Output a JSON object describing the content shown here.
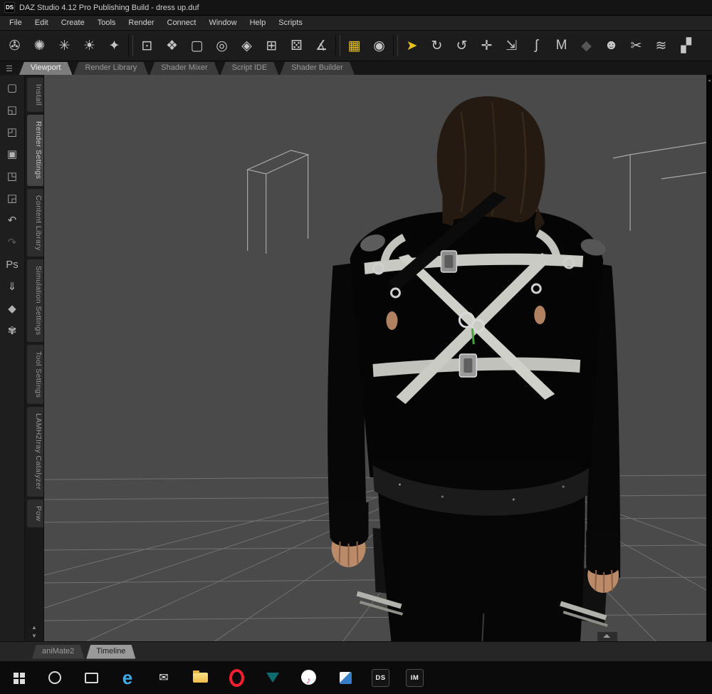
{
  "window": {
    "title": "DAZ Studio 4.12 Pro Publishing Build - dress up.duf",
    "app_initials": "DS"
  },
  "glyphs": {
    "pane_menu": "☰",
    "scroll_up": "▲",
    "scroll_down": "▼",
    "dock_handle": "◂"
  },
  "accent_colors": {
    "tool_highlight": "#e7c31d",
    "viewport_bg": "#4a4a4a"
  },
  "menu": {
    "items": [
      {
        "label": "File",
        "name": "menu-file"
      },
      {
        "label": "Edit",
        "name": "menu-edit"
      },
      {
        "label": "Create",
        "name": "menu-create"
      },
      {
        "label": "Tools",
        "name": "menu-tools"
      },
      {
        "label": "Render",
        "name": "menu-render"
      },
      {
        "label": "Connect",
        "name": "menu-connect"
      },
      {
        "label": "Window",
        "name": "menu-window"
      },
      {
        "label": "Help",
        "name": "menu-help"
      },
      {
        "label": "Scripts",
        "name": "menu-scripts"
      }
    ]
  },
  "toolbar": {
    "icons": [
      {
        "name": "new-camera-icon",
        "glyph": "✇"
      },
      {
        "name": "new-spotlight-icon",
        "glyph": "✺"
      },
      {
        "name": "new-point-light-icon",
        "glyph": "✳"
      },
      {
        "name": "new-distant-light-icon",
        "glyph": "☀"
      },
      {
        "name": "new-linear-light-icon",
        "glyph": "✦"
      },
      {
        "sep": true,
        "glyph": ""
      },
      {
        "name": "frame-camera-icon",
        "glyph": "⊡"
      },
      {
        "name": "new-primitive-icon",
        "glyph": "❖"
      },
      {
        "name": "bounding-box-icon",
        "glyph": "▢"
      },
      {
        "name": "aim-at-icon",
        "glyph": "◎"
      },
      {
        "name": "group-node-icon",
        "glyph": "◈"
      },
      {
        "name": "create-node-icon",
        "glyph": "⊞"
      },
      {
        "name": "instance-node-icon",
        "glyph": "⚄"
      },
      {
        "name": "measure-metrics-icon",
        "glyph": "∡"
      },
      {
        "sep": true,
        "glyph": ""
      },
      {
        "name": "render-icon",
        "glyph": "▦",
        "color": "#e7c31d"
      },
      {
        "name": "aux-viewport-icon",
        "glyph": "◉"
      },
      {
        "sep": true,
        "glyph": ""
      },
      {
        "name": "node-selection-tool-icon",
        "glyph": "➤",
        "color": "#e7c31d"
      },
      {
        "name": "rotate-tool-icon",
        "glyph": "↻"
      },
      {
        "name": "twist-tool-icon",
        "glyph": "↺"
      },
      {
        "name": "translate-tool-icon",
        "glyph": "✛"
      },
      {
        "name": "scale-tool-icon",
        "glyph": "⇲"
      },
      {
        "name": "active-pose-tool-icon",
        "glyph": "ʃ"
      },
      {
        "name": "surface-selection-tool-icon",
        "glyph": "M"
      },
      {
        "name": "node-weight-brush-icon",
        "glyph": "◆",
        "color": "#555555"
      },
      {
        "name": "joint-editor-tool-icon",
        "glyph": "☻"
      },
      {
        "name": "geometry-editor-tool-icon",
        "glyph": "✂"
      },
      {
        "name": "hair-tool-icon",
        "glyph": "≋"
      },
      {
        "name": "transfer-utility-icon",
        "glyph": "▞"
      }
    ]
  },
  "doc_tabs": {
    "items": [
      {
        "label": "Viewport",
        "name": "tab-viewport",
        "active": true
      },
      {
        "label": "Render Library",
        "name": "tab-render-library"
      },
      {
        "label": "Shader Mixer",
        "name": "tab-shader-mixer"
      },
      {
        "label": "Script IDE",
        "name": "tab-script-ide"
      },
      {
        "label": "Shader Builder",
        "name": "tab-shader-builder"
      }
    ]
  },
  "left_toolbar": {
    "icons": [
      {
        "name": "new-file-icon",
        "glyph": "▢"
      },
      {
        "name": "open-file-icon",
        "glyph": "◱"
      },
      {
        "name": "merge-file-icon",
        "glyph": "◰"
      },
      {
        "name": "save-icon",
        "glyph": "▣"
      },
      {
        "name": "save-last-icon",
        "glyph": "◳"
      },
      {
        "name": "export-icon",
        "glyph": "◲"
      },
      {
        "name": "undo-icon",
        "glyph": "↶"
      },
      {
        "name": "redo-icon",
        "glyph": "↷",
        "color": "#5a5a5a"
      },
      {
        "name": "photoshop-bridge-icon",
        "glyph": "Ps"
      },
      {
        "name": "render-queue-icon",
        "glyph": "⇓"
      },
      {
        "name": "smart-content-icon",
        "glyph": "◆"
      },
      {
        "name": "figure-setup-icon",
        "glyph": "✾"
      }
    ]
  },
  "side_tabs": {
    "items": [
      {
        "label": "Install",
        "name": "side-tab-install"
      },
      {
        "label": "Render Settings",
        "name": "side-tab-render-settings",
        "active": true
      },
      {
        "label": "Content Library",
        "name": "side-tab-content-library"
      },
      {
        "label": "Simulation Settings",
        "name": "side-tab-simulation-settings"
      },
      {
        "label": "Tool Settings",
        "name": "side-tab-tool-settings"
      },
      {
        "label": "LAMH2Iray Catalyzer",
        "name": "side-tab-lamh2iray-catalyzer"
      },
      {
        "label": "Pow",
        "name": "side-tab-pow"
      }
    ]
  },
  "bottom_tabs": {
    "items": [
      {
        "label": "aniMate2",
        "name": "tab-animate2"
      },
      {
        "label": "Timeline",
        "name": "tab-timeline",
        "active": true
      }
    ]
  },
  "viewport": {
    "description": "3D scene: back view of dark-haired figure in black outfit with white cross-strap harness, floor grid and wireframe boxes"
  },
  "taskbar": {
    "icons": [
      {
        "name": "start-button",
        "shape": "start",
        "glyph": ""
      },
      {
        "name": "cortana-button",
        "shape": "ring",
        "glyph": ""
      },
      {
        "name": "task-view-button",
        "shape": "taskview",
        "glyph": ""
      },
      {
        "name": "edge-icon",
        "shape": "edge",
        "glyph": "e",
        "color": "#3fabe8"
      },
      {
        "name": "mail-icon",
        "glyph": "✉",
        "color": "#e8e8e8"
      },
      {
        "name": "file-explorer-icon",
        "shape": "folder",
        "glyph": ""
      },
      {
        "name": "opera-icon",
        "shape": "opera",
        "glyph": ""
      },
      {
        "name": "predator-app-icon",
        "shape": "predator",
        "glyph": ""
      },
      {
        "name": "itunes-icon",
        "shape": "itunes",
        "glyph": "♪",
        "color": "#e0427a"
      },
      {
        "name": "blue-cube-app-icon",
        "shape": "clip",
        "glyph": ""
      },
      {
        "name": "daz-studio-icon",
        "shape": "badge",
        "glyph": "DS"
      },
      {
        "name": "install-manager-icon",
        "shape": "badge",
        "glyph": "IM"
      }
    ]
  }
}
